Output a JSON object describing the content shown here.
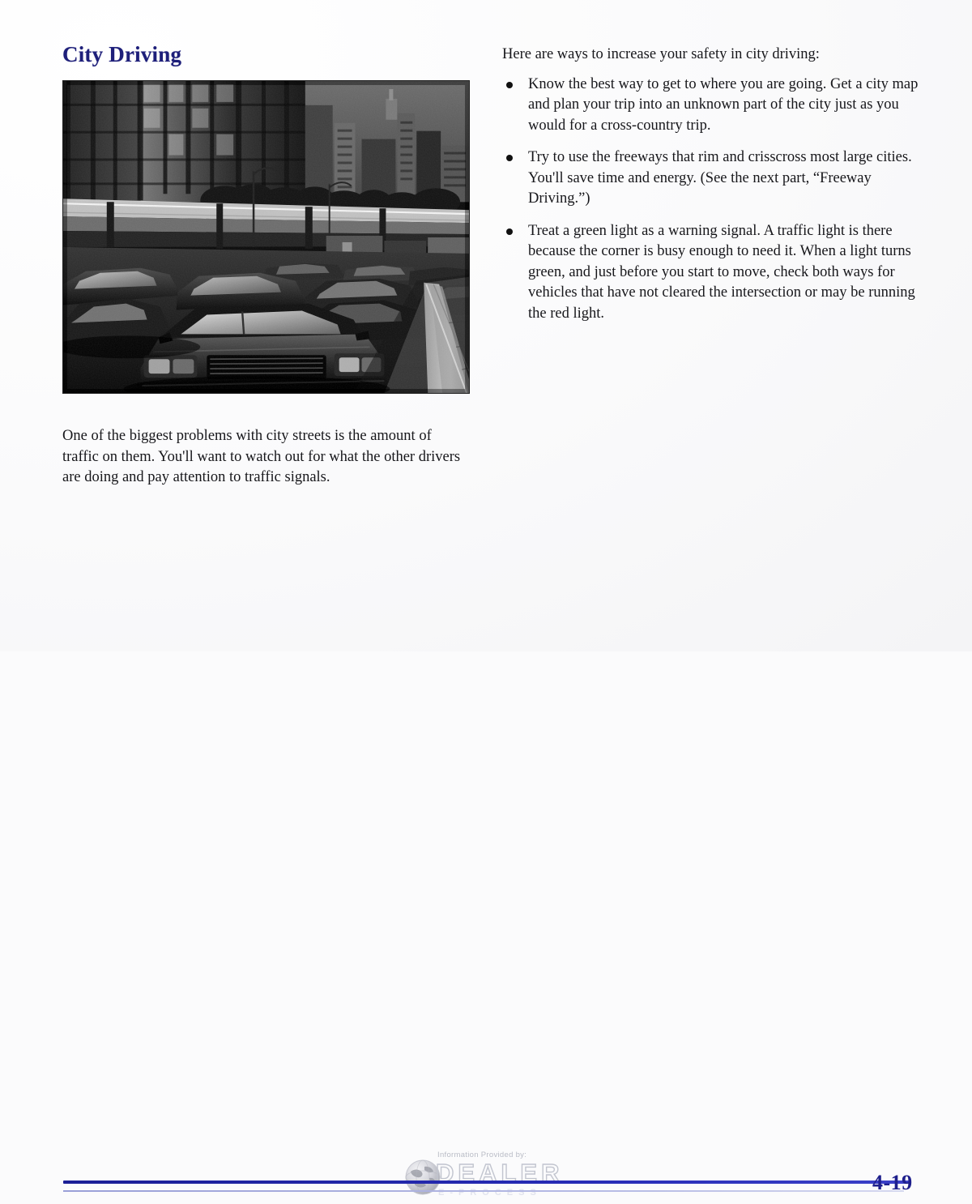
{
  "document": {
    "section_heading": "City Driving",
    "page_number": "4-19",
    "background_color": "#fbfbfc",
    "heading_color": "#1e1f7a",
    "rule_color": "#1b1f96"
  },
  "left_column": {
    "illustration": {
      "alt": "Black and white photograph of heavy traffic on a city street, with rows of cars stopped bumper to bumper, an elevated roadway and tall office buildings in the background, and a curbed sidewalk on the right",
      "icon_name": "city-traffic-photo"
    },
    "caption": "One of the biggest problems with city streets is the amount of traffic on them. You'll want to watch out for what the other drivers are doing and pay attention to traffic signals."
  },
  "right_column": {
    "intro": "Here are ways to increase your safety in city driving:",
    "bullets": [
      "Know the best way to get to where you are going. Get a city map and plan your trip into an unknown part of the city just as you would for a cross-country trip.",
      "Try to use the freeways that rim and crisscross most large cities. You'll save time and energy. (See the next part, “Freeway Driving.”)",
      "Treat a green light as a warning signal. A traffic light is there because the corner is busy enough to need it. When a light turns green, and just before you start to move, check both ways for vehicles that have not cleared the intersection or may be running the red light."
    ]
  },
  "watermark": {
    "label": "Information Provided by:",
    "word": "DEALER",
    "sub": "E-PROCESS",
    "icon_name": "globe-icon"
  }
}
